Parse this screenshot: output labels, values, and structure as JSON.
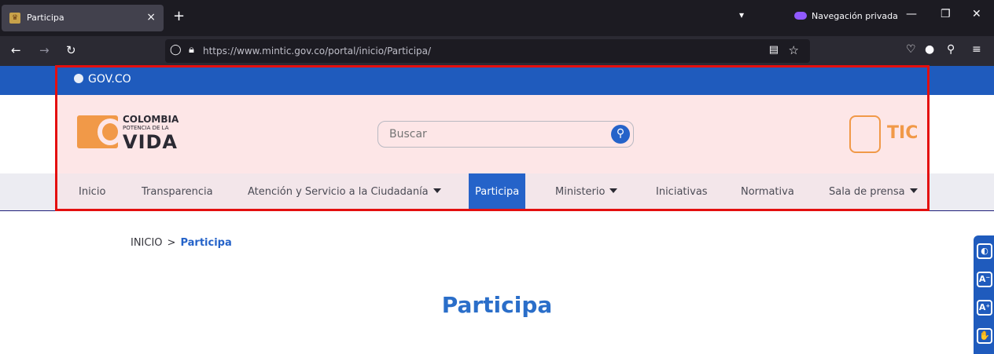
{
  "browser": {
    "tab_title": "Participa",
    "tab_close": "×",
    "new_tab": "+",
    "private_label": "Navegación privada",
    "url": "https://www.mintic.gov.co/portal/inicio/Participa/"
  },
  "site": {
    "gov_label": "GOV.CO",
    "logo": {
      "line1": "COLOMBIA",
      "line2": "POTENCIA DE LA",
      "line3": "VIDA"
    },
    "search_placeholder": "Buscar",
    "tic_label": "TIC",
    "menu": [
      {
        "label": "Inicio"
      },
      {
        "label": "Transparencia"
      },
      {
        "label": "Atención y Servicio a la Ciudadanía"
      },
      {
        "label": "Participa"
      },
      {
        "label": "Ministerio"
      },
      {
        "label": "Iniciativas"
      },
      {
        "label": "Normativa"
      },
      {
        "label": "Sala de prensa"
      }
    ],
    "breadcrumb": {
      "home": "INICIO",
      "separator": ">",
      "current": "Participa"
    },
    "page_title": "Participa"
  },
  "colors": {
    "gov_blue": "#1f5bbd",
    "active_blue": "#2563c9",
    "highlight_red": "#e40f0f",
    "brand_orange": "#f19948"
  }
}
